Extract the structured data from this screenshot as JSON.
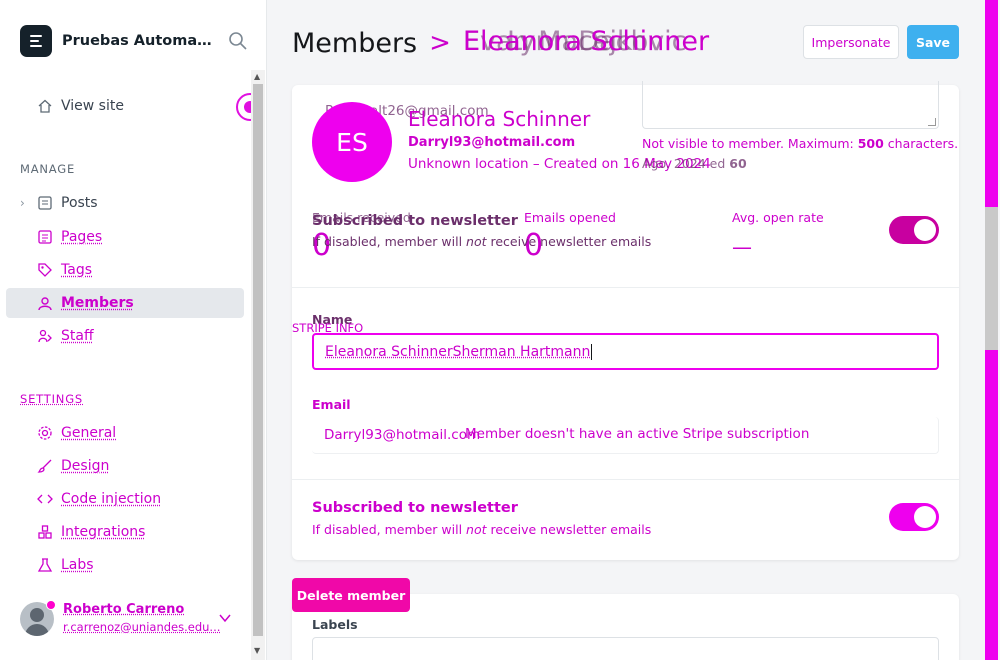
{
  "app": {
    "site_name": "Pruebas Automati...",
    "search_icon": "search-icon"
  },
  "sidebar": {
    "view_site": "View site",
    "manage_title": "MANAGE",
    "manage_items": [
      {
        "label": "Posts",
        "icon": "posts-icon"
      },
      {
        "label": "Pages",
        "icon": "pages-icon"
      },
      {
        "label": "Tags",
        "icon": "tag-icon"
      },
      {
        "label": "Members",
        "icon": "members-icon"
      },
      {
        "label": "Staff",
        "icon": "staff-icon"
      }
    ],
    "settings_title": "SETTINGS",
    "settings_items": [
      {
        "label": "General",
        "icon": "gear-icon"
      },
      {
        "label": "Design",
        "icon": "brush-icon"
      },
      {
        "label": "Code injection",
        "icon": "code-icon"
      },
      {
        "label": "Integrations",
        "icon": "integrations-icon"
      },
      {
        "label": "Labs",
        "icon": "flask-icon"
      }
    ],
    "user": {
      "name": "Roberto Carreno",
      "email": "r.carrenoz@uniandes.edu..."
    }
  },
  "header": {
    "crumb_root": "Members",
    "crumb_sep": ">",
    "crumb_current": "Eleanora Schinner",
    "crumb_ghost_1": "Evan Macejkovic",
    "crumb_ghost_2": "Lynn Dach",
    "impersonate_label": "Impersonate",
    "save_label": "Save"
  },
  "member": {
    "initials": "ES",
    "name": "Eleanora Schinner",
    "email": "Darryl93@hotmail.com",
    "meta": "Unknown location – Created on 16 May 2024",
    "ghost_email": "Reese.alt26@gmail.com",
    "ghost_stat": "Ago. 2024 ed",
    "ghost_stat_num": "60"
  },
  "note": {
    "hint_prefix": "Not visible to member. Maximum: ",
    "hint_max": "500",
    "hint_suffix": " characters."
  },
  "stats": {
    "emails_received_label": "Emails received",
    "emails_received_value": "0",
    "emails_opened_label": "Emails opened",
    "emails_opened_value": "0",
    "open_rate_label": "Avg. open rate",
    "open_rate_value": "—"
  },
  "newsletter_overlay": {
    "title": "Subscribed to newsletter",
    "desc_pre": "If disabled, member will ",
    "desc_em": "not",
    "desc_post": " receive newsletter emails"
  },
  "form": {
    "stripe_info": "STRIPE INFO",
    "name_label": "Name",
    "name_value": "Eleanora SchinnerSherman Hartmann",
    "email_label": "Email",
    "email_value": "Darryl93@hotmail.com",
    "stripe_note": "Member doesn't have an active Stripe subscription"
  },
  "newsletter": {
    "title": "Subscribed to newsletter",
    "desc_pre": "If disabled, member will ",
    "desc_em": "not",
    "desc_post": " receive newsletter emails"
  },
  "actions": {
    "delete_label": "Delete member",
    "labels_title": "Labels"
  },
  "colors": {
    "accent": "#ee00ee",
    "save_blue": "#3eb0ef",
    "delete_pink": "#f008a8"
  }
}
